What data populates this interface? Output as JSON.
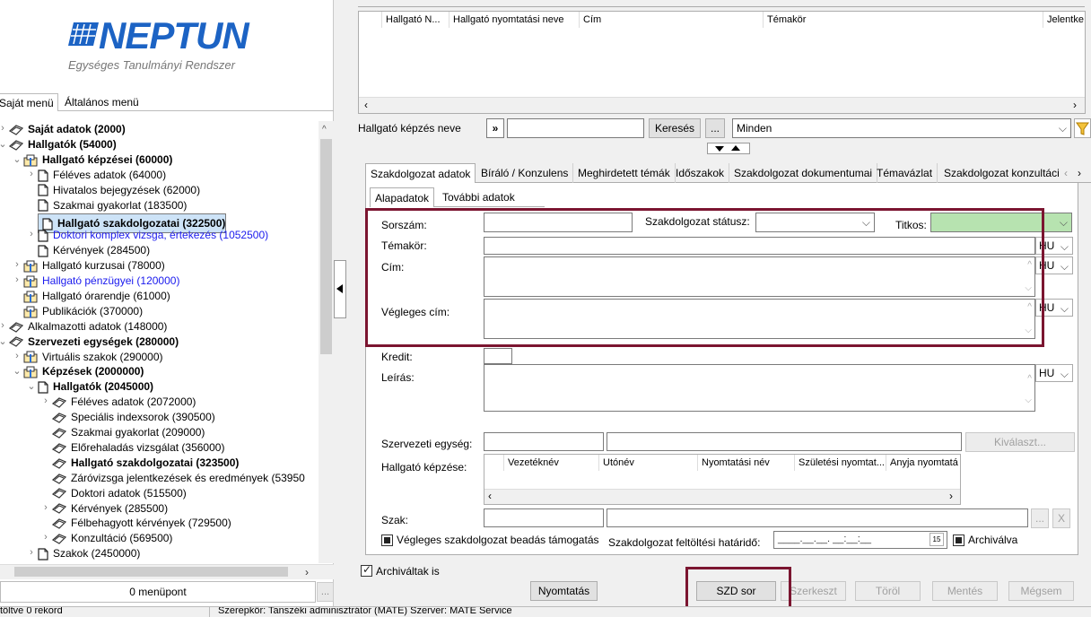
{
  "left": {
    "logo": {
      "name": "NEPTUN",
      "subtitle": "Egységes Tanulmányi Rendszer"
    },
    "menu_tabs": [
      "Saját menü",
      "Általános menü"
    ],
    "tree": [
      {
        "label": "Saját adatok (2000)"
      },
      {
        "label": "Hallgatók (54000)"
      },
      {
        "label": "Hallgató képzései (60000)"
      },
      {
        "label": "Féléves adatok (64000)"
      },
      {
        "label": "Hivatalos bejegyzések (62000)"
      },
      {
        "label": "Szakmai gyakorlat (183500)"
      },
      {
        "label": "Hallgató szakdolgozatai (322500)"
      },
      {
        "label": "Doktori komplex vizsga, értekezés (1052500)"
      },
      {
        "label": "Kérvények (284500)"
      },
      {
        "label": "Hallgató kurzusai (78000)"
      },
      {
        "label": "Hallgató pénzügyei (120000)"
      },
      {
        "label": "Hallgató órarendje (61000)"
      },
      {
        "label": "Publikációk (370000)"
      },
      {
        "label": "Alkalmazotti adatok (148000)"
      },
      {
        "label": "Szervezeti egységek (280000)"
      },
      {
        "label": "Virtuális szakok (290000)"
      },
      {
        "label": "Képzések (2000000)"
      },
      {
        "label": "Hallgatók (2045000)"
      },
      {
        "label": "Féléves adatok (2072000)"
      },
      {
        "label": "Speciális indexsorok (390500)"
      },
      {
        "label": "Szakmai gyakorlat (209000)"
      },
      {
        "label": "Előrehaladás vizsgálat (356000)"
      },
      {
        "label": "Hallgató szakdolgozatai (323500)"
      },
      {
        "label": "Záróvizsga jelentkezések és eredmények (53950"
      },
      {
        "label": "Doktori adatok (515500)"
      },
      {
        "label": "Kérvények (285500)"
      },
      {
        "label": "Félbehagyott kérvények (729500)"
      },
      {
        "label": "Konzultáció (569500)"
      },
      {
        "label": "Szakok (2450000)"
      }
    ],
    "menu_count": "0 menüpont",
    "menu_dots": "..."
  },
  "status": {
    "records": "töltve 0 rekord",
    "role": "Szerepkör: Tanszéki adminisztrátor (MATE)   Szerver: MATE Service"
  },
  "top_grid": {
    "columns": [
      "Hallgató N...",
      "Hallgató nyomtatási neve",
      "Cím",
      "Témakör",
      "Jelentke"
    ]
  },
  "search": {
    "label": "Hallgató képzés neve",
    "arrow": "»",
    "button": "Keresés",
    "dots": "...",
    "filter_value": "Minden"
  },
  "tabs": [
    "Szakdolgozat adatok",
    "Bíráló / Konzulens",
    "Meghirdetett témák",
    "Időszakok",
    "Szakdolgozat dokumentumai",
    "Témavázlat",
    "Szakdolgozat konzultáci"
  ],
  "subtabs": [
    "Alapadatok",
    "További adatok"
  ],
  "form": {
    "sorszam": "Sorszám:",
    "statusz": "Szakdolgozat státusz:",
    "titkos": "Titkos:",
    "temakor": "Témakör:",
    "cim": "Cím:",
    "vegleges_cim": "Végleges cím:",
    "kredit": "Kredit:",
    "leiras": "Leírás:",
    "szervezeti": "Szervezeti egység:",
    "kivalaszt": "Kiválaszt...",
    "kepzese": "Hallgató képzése:",
    "kepzes_columns": [
      "Vezetéknév",
      "Utónév",
      "Nyomtatási név",
      "Születési nyomtat...",
      "Anyja nyomtatá"
    ],
    "szak": "Szak:",
    "szak_dots": "...",
    "szak_x": "X",
    "lang": "HU",
    "vegleges_check": "Végleges szakdolgozat beadás támogatás",
    "hatarido": "Szakdolgozat feltöltési határidő:",
    "date_placeholder": "____.__.__. __:__:__",
    "cal": "15",
    "archivalva": "Archiválva"
  },
  "bottom": {
    "archived_check": "Archiváltak is",
    "nyomtatas": "Nyomtatás",
    "szd_sor": "SZD sor",
    "szerkeszt": "Szerkeszt",
    "torol": "Töröl",
    "mentes": "Mentés",
    "megsem": "Mégsem"
  },
  "colors": {
    "highlight": "#7b1530",
    "brand": "#1c63c4",
    "link": "#1a1aee"
  }
}
